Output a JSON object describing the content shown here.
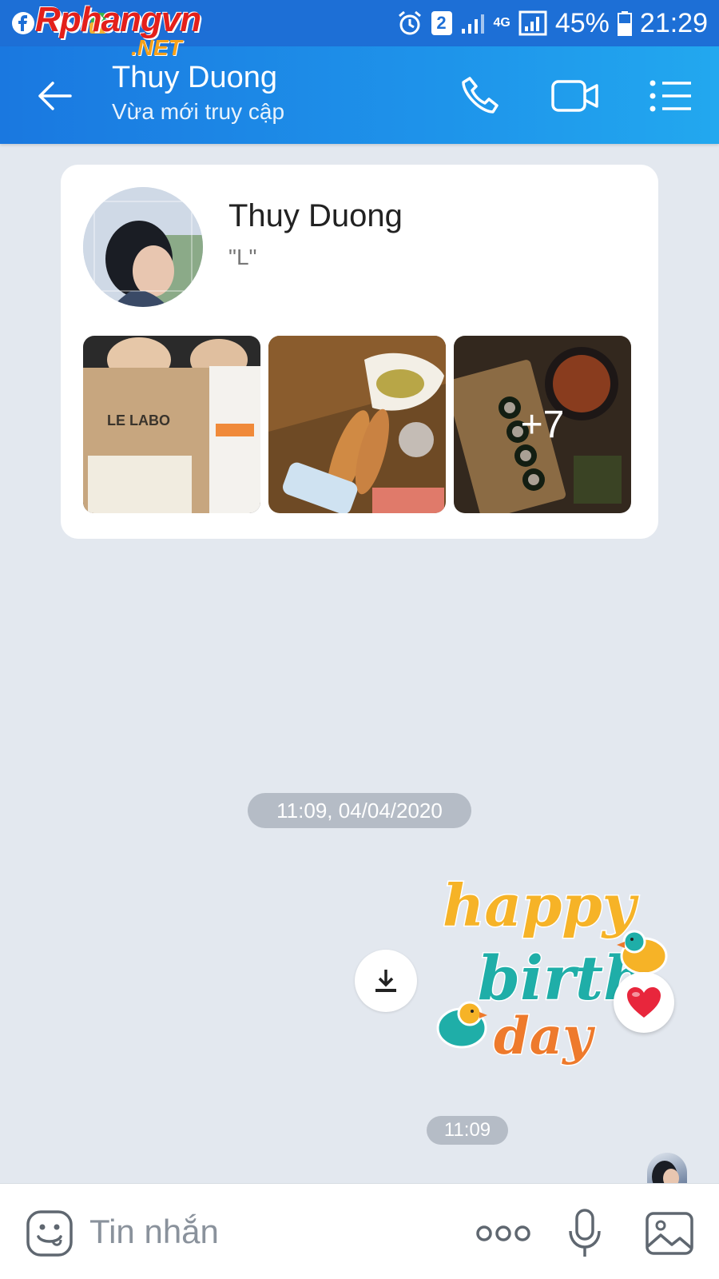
{
  "status_bar": {
    "icons_left": [
      "facebook-icon",
      "cloud-icon",
      "app-icon"
    ],
    "notification_count": "2",
    "network": "4G",
    "battery": "45%",
    "time": "21:29"
  },
  "watermark": {
    "main": "Rphangvn",
    "sub": ".NET"
  },
  "header": {
    "title": "Thuy Duong",
    "subtitle": "Vừa mới truy cập",
    "icons": [
      "back-arrow-icon",
      "phone-icon",
      "video-icon",
      "menu-icon"
    ]
  },
  "profile": {
    "name": "Thuy Duong",
    "status": "\"L\"",
    "photos": [
      {
        "caption": "LE LABO"
      },
      {
        "caption": ""
      },
      {
        "caption": ""
      }
    ],
    "more_count": "+7"
  },
  "chat": {
    "date_separator": "11:09, 04/04/2020",
    "sticker": {
      "line1": "happy",
      "line2": "birth",
      "line3": "day"
    },
    "message_time": "11:09"
  },
  "input_bar": {
    "placeholder": "Tin nhắn",
    "icons": [
      "emoji-icon",
      "more-icon",
      "microphone-icon",
      "image-icon"
    ]
  },
  "colors": {
    "header": "#1e8fe8",
    "background": "#e3e8ef",
    "pill": "#b5bcc6"
  }
}
